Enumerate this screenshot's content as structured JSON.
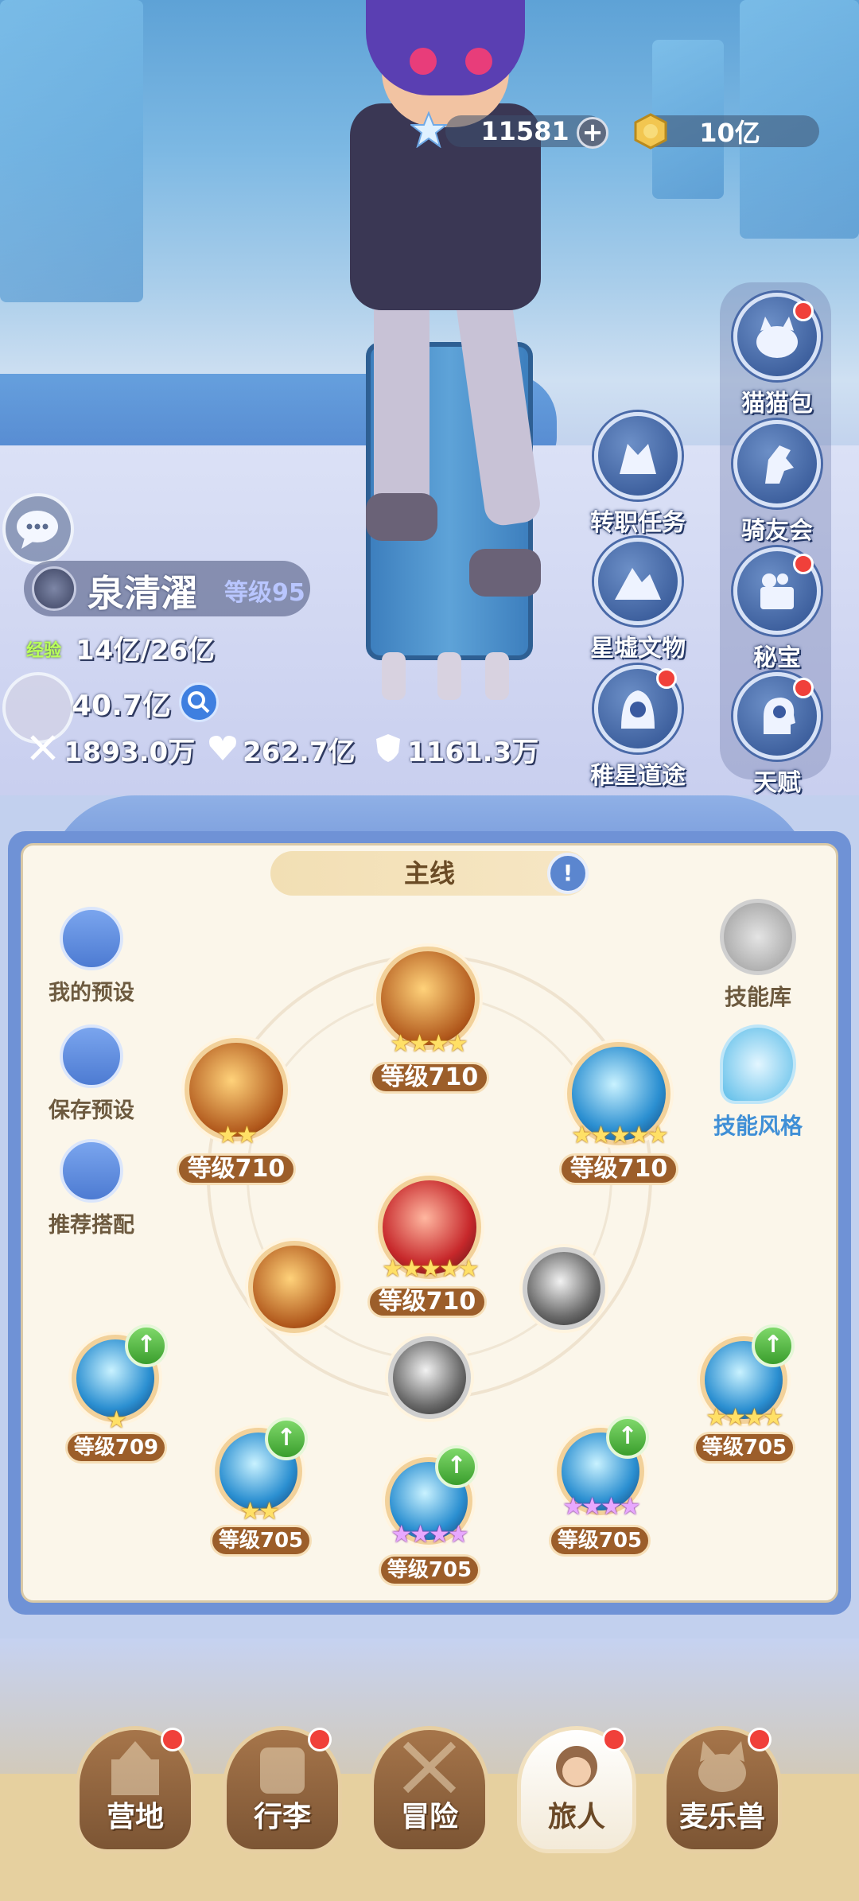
{
  "currency": {
    "stars": "11581",
    "gold": "10亿",
    "plus": "+"
  },
  "side_menu": [
    {
      "label": "猫猫包",
      "icon": "cat-bag-icon",
      "badge": true
    },
    {
      "label": "骑友会",
      "icon": "horse-icon",
      "badge": false
    },
    {
      "label": "秘宝",
      "icon": "treasure-icon",
      "badge": true
    },
    {
      "label": "天赋",
      "icon": "talent-head-icon",
      "badge": true
    }
  ],
  "mid_menu": [
    {
      "label": "转职任务",
      "icon": "class-change-icon",
      "badge": false
    },
    {
      "label": "星墟文物",
      "icon": "relic-mountain-icon",
      "badge": false
    },
    {
      "label": "稚星道途",
      "icon": "hooded-figure-icon",
      "badge": true
    }
  ],
  "player": {
    "name": "泉清濯",
    "level": "等级95",
    "exp_label": "经验",
    "exp": "14亿/26亿",
    "power": "40.7亿",
    "attack": "1893.0万",
    "hp": "262.7亿",
    "defense": "1161.3万"
  },
  "panel": {
    "tab": "主线",
    "tab_icon": "!",
    "left_buttons": [
      "我的预设",
      "保存预设",
      "推荐搭配"
    ],
    "right_buttons": [
      "技能库",
      "技能风格"
    ]
  },
  "skills": {
    "top": {
      "level": "等级710",
      "stars": "★★★★"
    },
    "upper_left": {
      "level": "等级710",
      "stars": "★★"
    },
    "upper_right": {
      "level": "等级710",
      "stars": "★★★★★"
    },
    "center": {
      "level": "等级710",
      "stars": "★★★★★"
    },
    "row1": {
      "level": "等级709",
      "stars": "★",
      "up": "↑"
    },
    "row2": {
      "level": "等级705",
      "stars": "★★",
      "up": "↑"
    },
    "row3": {
      "level": "等级705",
      "stars": "★★★★",
      "up": "↑"
    },
    "row4": {
      "level": "等级705",
      "stars": "★★★★",
      "up": "↑"
    },
    "row5": {
      "level": "等级705",
      "stars": "★★★★",
      "up": "↑"
    }
  },
  "nav": [
    {
      "label": "营地",
      "badge": true
    },
    {
      "label": "行李",
      "badge": true
    },
    {
      "label": "冒险",
      "badge": false
    },
    {
      "label": "旅人",
      "badge": true,
      "active": true
    },
    {
      "label": "麦乐兽",
      "badge": true
    }
  ],
  "colors": {
    "accent_blue": "#6f92d6",
    "badge_red": "#f0403a",
    "level_brown": "#9c5e2a",
    "upgrade_green": "#3a9e2d"
  }
}
